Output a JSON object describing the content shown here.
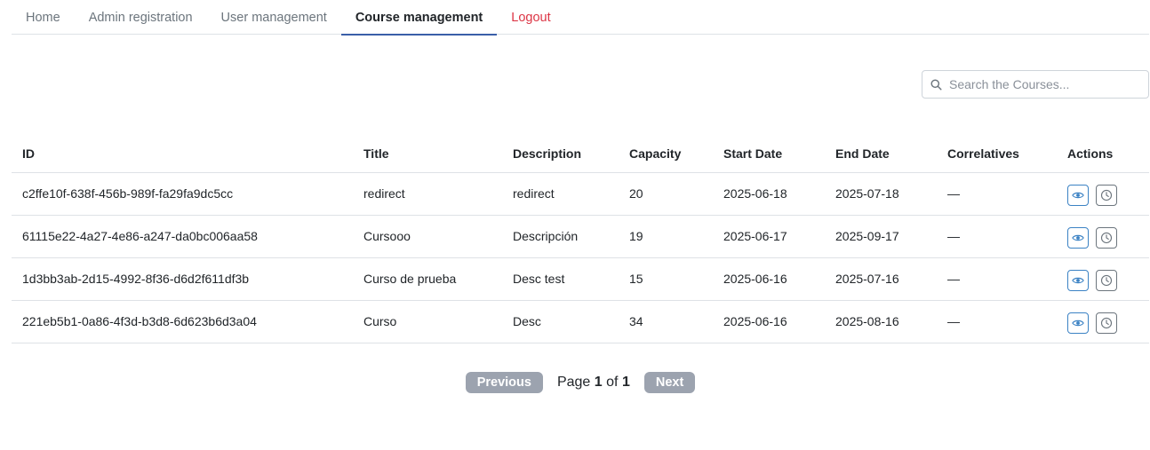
{
  "nav": {
    "items": [
      {
        "label": "Home",
        "name": "tab-home",
        "active": false
      },
      {
        "label": "Admin registration",
        "name": "tab-admin-registration",
        "active": false
      },
      {
        "label": "User management",
        "name": "tab-user-management",
        "active": false
      },
      {
        "label": "Course management",
        "name": "tab-course-management",
        "active": true
      },
      {
        "label": "Logout",
        "name": "logout-link",
        "active": false
      }
    ],
    "active_color": "#3a5fa8",
    "logout_color": "#dc3545"
  },
  "search": {
    "placeholder": "Search the Courses...",
    "value": "",
    "icon": "search-icon"
  },
  "table": {
    "columns": [
      "ID",
      "Title",
      "Description",
      "Capacity",
      "Start Date",
      "End Date",
      "Correlatives",
      "Actions"
    ],
    "rows": [
      {
        "id": "c2ffe10f-638f-456b-989f-fa29fa9dc5cc",
        "title": "redirect",
        "description": "redirect",
        "capacity": "20",
        "start": "2025-06-18",
        "end": "2025-07-18",
        "correlatives": "—"
      },
      {
        "id": "61115e22-4a27-4e86-a247-da0bc006aa58",
        "title": "Cursooo",
        "description": "Descripción",
        "capacity": "19",
        "start": "2025-06-17",
        "end": "2025-09-17",
        "correlatives": "—"
      },
      {
        "id": "1d3bb3ab-2d15-4992-8f36-d6d2f611df3b",
        "title": "Curso de prueba",
        "description": "Desc test",
        "capacity": "15",
        "start": "2025-06-16",
        "end": "2025-07-16",
        "correlatives": "—"
      },
      {
        "id": "221eb5b1-0a86-4f3d-b3d8-6d623b6d3a04",
        "title": "Curso",
        "description": "Desc",
        "capacity": "34",
        "start": "2025-06-16",
        "end": "2025-08-16",
        "correlatives": "—"
      }
    ],
    "action_icons": [
      "eye-icon",
      "clock-icon"
    ],
    "view_color": "#3b82c4",
    "history_color": "#6c757d"
  },
  "pagination": {
    "previous_label": "Previous",
    "next_label": "Next",
    "page_word": "Page",
    "of_word": "of",
    "current_page": "1",
    "total_pages": "1",
    "button_color": "#9ca3af"
  }
}
